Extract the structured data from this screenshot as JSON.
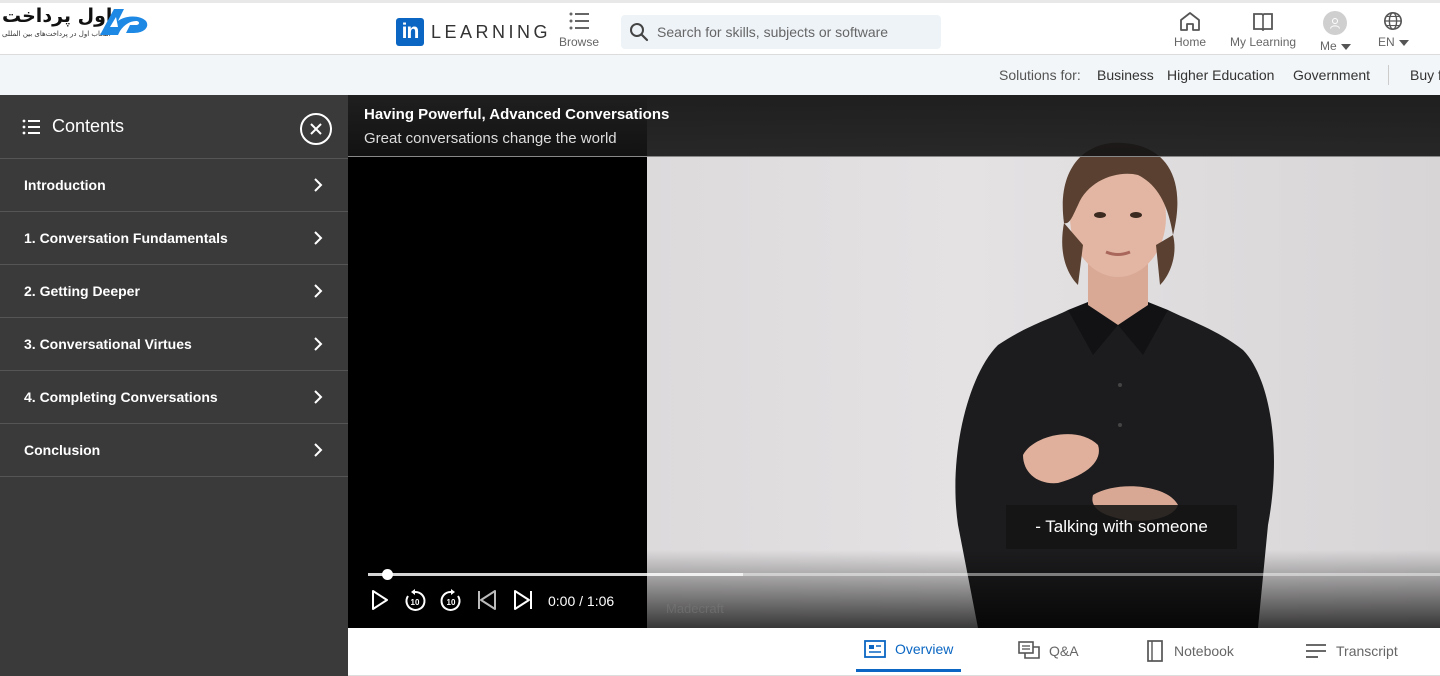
{
  "brand": {
    "name_fa": "اول پرداخت",
    "tagline_fa": "انتخاب اول در پرداخت‌های بین المللی"
  },
  "header": {
    "product_name": "LEARNING",
    "li_mark": "in",
    "browse_label": "Browse",
    "search_placeholder": "Search for skills, subjects or software",
    "home_label": "Home",
    "my_learning_label": "My Learning",
    "me_label": "Me",
    "lang_label": "EN"
  },
  "subbar": {
    "solutions_label": "Solutions for:",
    "links": [
      "Business",
      "Higher Education",
      "Government"
    ],
    "buy_label": "Buy f"
  },
  "sidebar": {
    "title": "Contents",
    "chapters": [
      {
        "label": "Introduction"
      },
      {
        "label": "1. Conversation Fundamentals"
      },
      {
        "label": "2. Getting Deeper"
      },
      {
        "label": "3. Conversational Virtues"
      },
      {
        "label": "4. Completing Conversations"
      },
      {
        "label": "Conclusion"
      }
    ]
  },
  "player": {
    "course_title": "Having Powerful, Advanced Conversations",
    "video_title": "Great conversations change the world",
    "caption": "- Talking with someone",
    "time_display": "0:00 / 1:06",
    "progress_fraction": 0.013,
    "buffered_fraction": 0.35,
    "watermark": "Madecraft"
  },
  "tabs": [
    {
      "label": "Overview",
      "icon": "overview-icon",
      "active": true
    },
    {
      "label": "Q&A",
      "icon": "qa-icon",
      "active": false
    },
    {
      "label": "Notebook",
      "icon": "notebook-icon",
      "active": false
    },
    {
      "label": "Transcript",
      "icon": "transcript-icon",
      "active": false
    }
  ],
  "colors": {
    "accent": "#0a66c2",
    "sidebar_bg": "#3a3a3a",
    "subbar_bg": "#f3f6f8"
  }
}
